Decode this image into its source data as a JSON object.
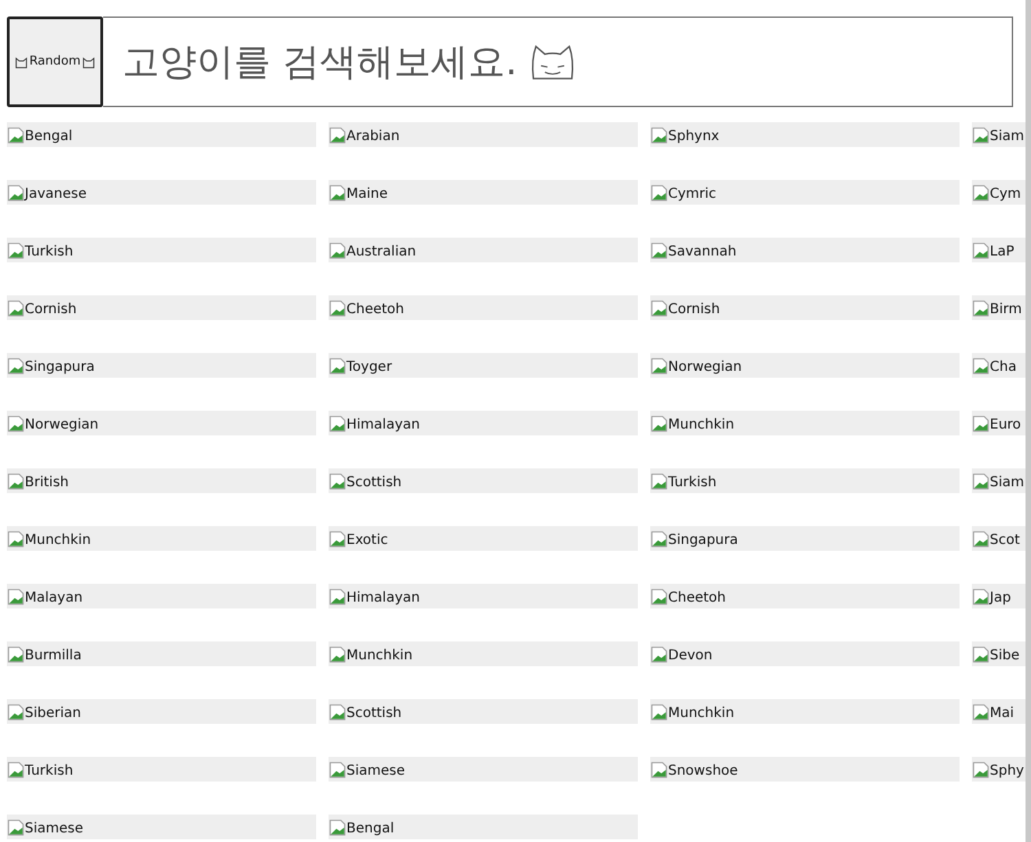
{
  "random_button": {
    "label": "Random"
  },
  "search": {
    "placeholder": "고양이를 검색해보세요."
  },
  "cats": [
    {
      "alt": "Bengal"
    },
    {
      "alt": "Arabian"
    },
    {
      "alt": "Sphynx"
    },
    {
      "alt": "Siam"
    },
    {
      "alt": "Javanese"
    },
    {
      "alt": "Maine"
    },
    {
      "alt": "Cymric"
    },
    {
      "alt": "Cym"
    },
    {
      "alt": "Turkish"
    },
    {
      "alt": "Australian"
    },
    {
      "alt": "Savannah"
    },
    {
      "alt": "LaP"
    },
    {
      "alt": "Cornish"
    },
    {
      "alt": "Cheetoh"
    },
    {
      "alt": "Cornish"
    },
    {
      "alt": "Birm"
    },
    {
      "alt": "Singapura"
    },
    {
      "alt": "Toyger"
    },
    {
      "alt": "Norwegian"
    },
    {
      "alt": "Cha"
    },
    {
      "alt": "Norwegian"
    },
    {
      "alt": "Himalayan"
    },
    {
      "alt": "Munchkin"
    },
    {
      "alt": "Euro"
    },
    {
      "alt": "British"
    },
    {
      "alt": "Scottish"
    },
    {
      "alt": "Turkish"
    },
    {
      "alt": "Siam"
    },
    {
      "alt": "Munchkin"
    },
    {
      "alt": "Exotic"
    },
    {
      "alt": "Singapura"
    },
    {
      "alt": "Scot"
    },
    {
      "alt": "Malayan"
    },
    {
      "alt": "Himalayan"
    },
    {
      "alt": "Cheetoh"
    },
    {
      "alt": "Jap"
    },
    {
      "alt": "Burmilla"
    },
    {
      "alt": "Munchkin"
    },
    {
      "alt": "Devon"
    },
    {
      "alt": "Sibe"
    },
    {
      "alt": "Siberian"
    },
    {
      "alt": "Scottish"
    },
    {
      "alt": "Munchkin"
    },
    {
      "alt": "Mai"
    },
    {
      "alt": "Turkish"
    },
    {
      "alt": "Siamese"
    },
    {
      "alt": "Snowshoe"
    },
    {
      "alt": "Sphy"
    },
    {
      "alt": "Siamese"
    },
    {
      "alt": "Bengal"
    }
  ]
}
